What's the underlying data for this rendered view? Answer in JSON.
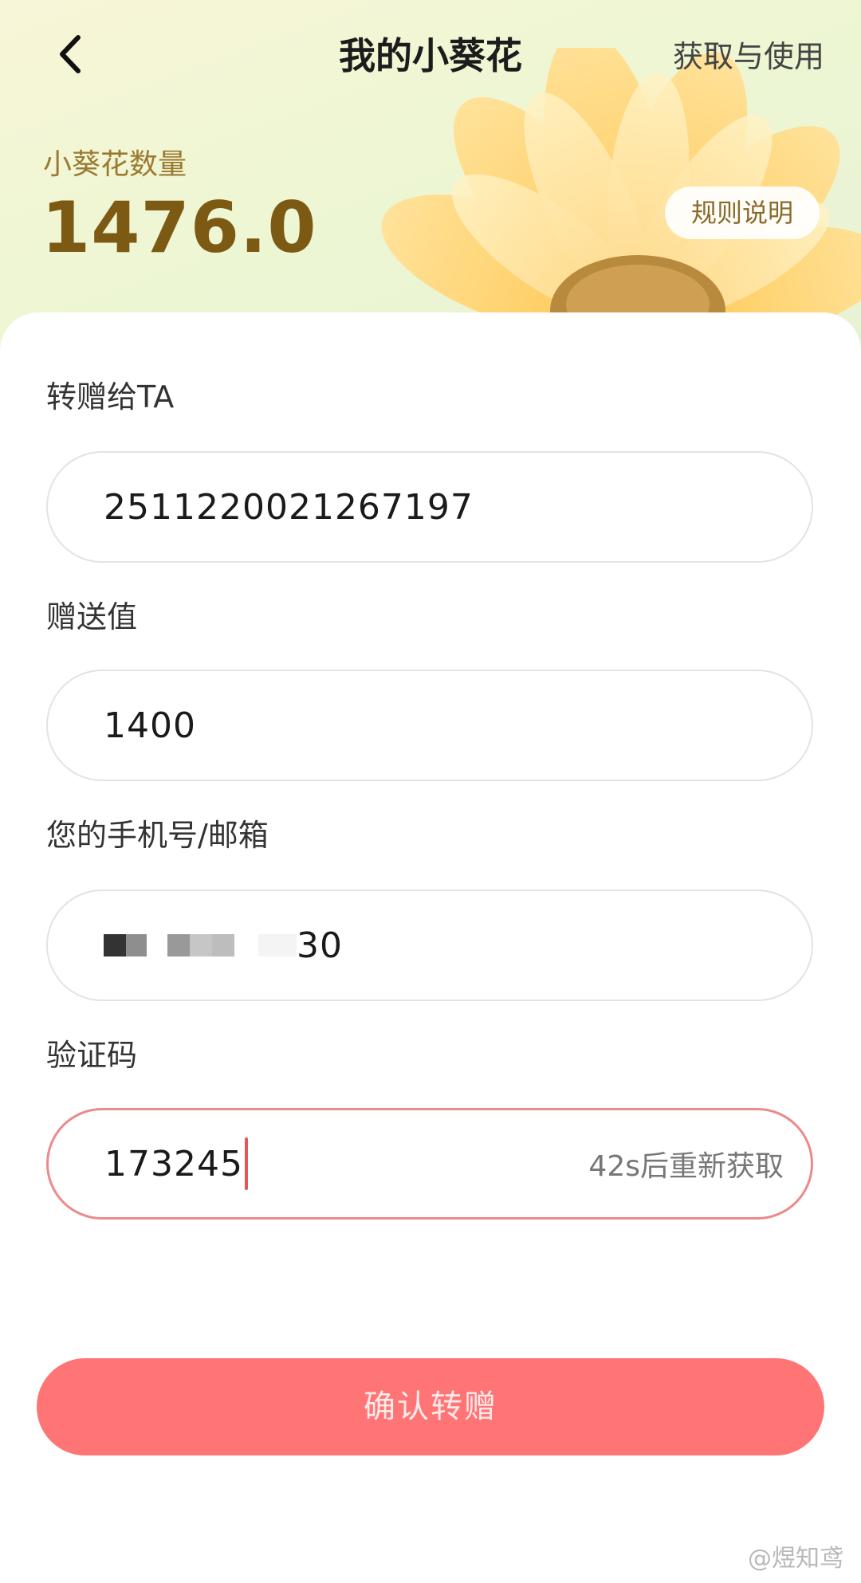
{
  "header": {
    "title": "我的小葵花",
    "right_link": "获取与使用",
    "balance_label": "小葵花数量",
    "balance_value": "1476.0",
    "rules_button": "规则说明"
  },
  "form": {
    "recipient": {
      "label": "转赠给TA",
      "value": "2511220021267197"
    },
    "amount": {
      "label": "赠送值",
      "value": "1400"
    },
    "contact": {
      "label": "您的手机号/邮箱",
      "visible_suffix": "30"
    },
    "code": {
      "label": "验证码",
      "value": "173245",
      "resend": "42s后重新获取"
    }
  },
  "actions": {
    "confirm": "确认转赠"
  },
  "watermark": "@煜知鸢",
  "colors": {
    "accent": "#ff7474",
    "balance": "#7c5a14",
    "active_border": "#ec8a8a"
  },
  "icons": {
    "back": "chevron-left-icon",
    "decor": "sunflower-decoration"
  }
}
